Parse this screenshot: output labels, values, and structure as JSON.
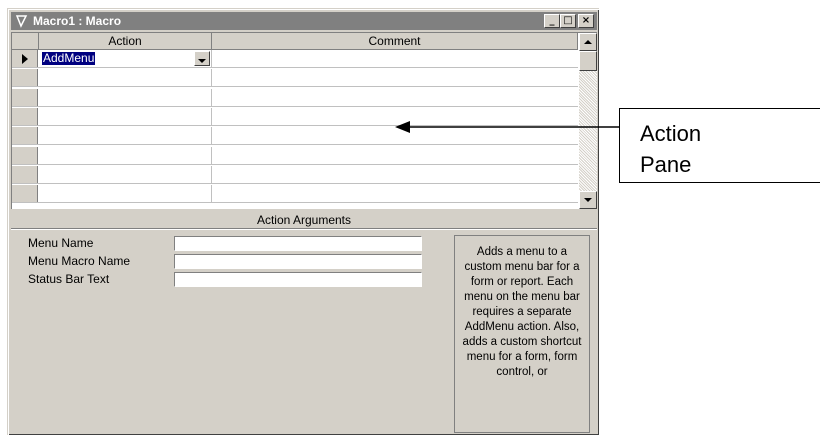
{
  "window": {
    "title": "Macro1 : Macro"
  },
  "titlebar_buttons": {
    "minimize": "_",
    "maximize": "□",
    "close": "×"
  },
  "grid": {
    "columns": [
      "Action",
      "Comment"
    ],
    "rows": [
      {
        "action": "AddMenu",
        "comment": ""
      },
      {
        "action": "",
        "comment": ""
      },
      {
        "action": "",
        "comment": ""
      },
      {
        "action": "",
        "comment": ""
      },
      {
        "action": "",
        "comment": ""
      },
      {
        "action": "",
        "comment": ""
      },
      {
        "action": "",
        "comment": ""
      },
      {
        "action": "",
        "comment": ""
      }
    ]
  },
  "arguments": {
    "title": "Action Arguments",
    "fields": [
      {
        "label": "Menu Name",
        "value": ""
      },
      {
        "label": "Menu Macro Name",
        "value": ""
      },
      {
        "label": "Status Bar Text",
        "value": ""
      }
    ],
    "help_text": "Adds a menu to a custom menu bar for a form or report. Each menu on the menu bar requires a separate AddMenu action. Also, adds a custom shortcut menu for a form, form control, or"
  },
  "callout": {
    "line1": "Action",
    "line2": "Pane"
  },
  "icons": {
    "title": "macro-icon",
    "current_row": "row-pointer-icon",
    "dropdown": "dropdown-arrow-icon"
  }
}
